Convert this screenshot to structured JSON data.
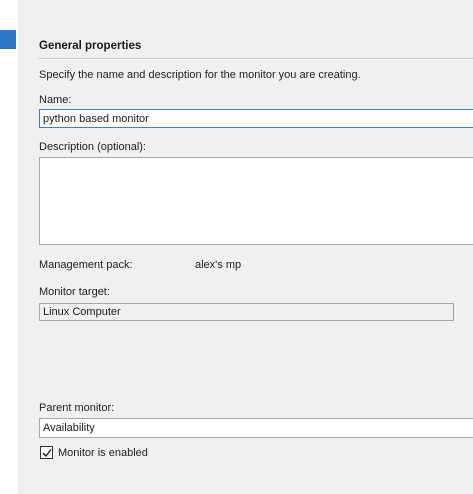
{
  "section": {
    "title": "General properties",
    "instruction": "Specify the name and description for the monitor you are creating."
  },
  "name_field": {
    "label": "Name:",
    "value": "python based monitor"
  },
  "description_field": {
    "label": "Description (optional):",
    "value": ""
  },
  "management_pack": {
    "label": "Management pack:",
    "value": "alex's mp"
  },
  "monitor_target": {
    "label": "Monitor target:",
    "value": "Linux Computer"
  },
  "parent_monitor": {
    "label": "Parent monitor:",
    "value": "Availability"
  },
  "enabled_checkbox": {
    "label": "Monitor is enabled",
    "checked": true
  },
  "colors": {
    "panel_background": "#f0f0f0",
    "nav_accent": "#2f75c6",
    "focus_border": "#3c7fd0"
  },
  "icons": {
    "checkbox_mark": "check-icon"
  }
}
